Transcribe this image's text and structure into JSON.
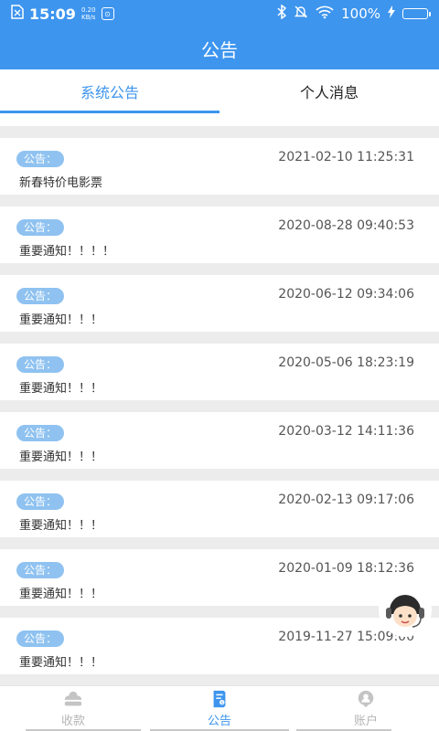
{
  "status_bar": {
    "time": "15:09",
    "speed_value": "0.20",
    "speed_unit": "KB/s",
    "battery": "100%"
  },
  "header": {
    "title": "公告"
  },
  "tabs": [
    {
      "label": "系统公告",
      "active": true
    },
    {
      "label": "个人消息",
      "active": false
    }
  ],
  "notices": [
    {
      "badge": "公告：",
      "date": "2021-02-10 11:25:31",
      "title": "新春特价电影票"
    },
    {
      "badge": "公告：",
      "date": "2020-08-28 09:40:53",
      "title": "重要通知！！！！"
    },
    {
      "badge": "公告：",
      "date": "2020-06-12 09:34:06",
      "title": "重要通知！！！"
    },
    {
      "badge": "公告：",
      "date": "2020-05-06 18:23:19",
      "title": "重要通知！！！"
    },
    {
      "badge": "公告：",
      "date": "2020-03-12 14:11:36",
      "title": "重要通知！！！"
    },
    {
      "badge": "公告：",
      "date": "2020-02-13 09:17:06",
      "title": "重要通知！！！"
    },
    {
      "badge": "公告：",
      "date": "2020-01-09 18:12:36",
      "title": "重要通知！！！"
    },
    {
      "badge": "公告：",
      "date": "2019-11-27 15:09:00",
      "title": "重要通知！！！"
    }
  ],
  "bottom_nav": [
    {
      "label": "收款",
      "icon": "receive-money-icon",
      "active": false
    },
    {
      "label": "公告",
      "icon": "notice-icon",
      "active": true
    },
    {
      "label": "账户",
      "icon": "account-icon",
      "active": false
    }
  ],
  "colors": {
    "primary": "#3d95ee",
    "badge": "#8fc2f0",
    "inactive": "#b5b5b5"
  }
}
